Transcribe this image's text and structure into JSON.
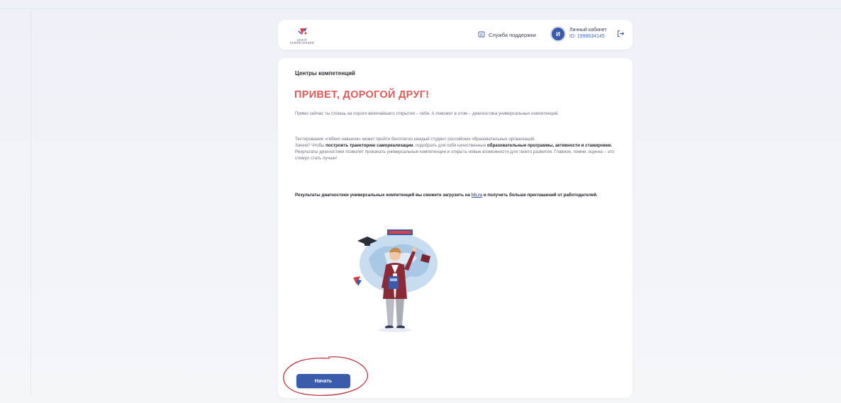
{
  "header": {
    "logo_text": "ЦЕНТР КОМПЕТЕНЦИЙ",
    "support_label": "Служба поддержки",
    "avatar_letter": "И",
    "account_label": "Личный кабинет",
    "account_id": "ID: 1998634145"
  },
  "main": {
    "section_title": "Центры компетенций",
    "greeting": "ПРИВЕТ, ДОРОГОЙ ДРУГ!",
    "p1": "Прямо сейчас ты стоишь на пороге величайшего открытия – себя. А поможет в этом – диагностика универсальных компетенций.",
    "p2_line1": "Тестирование «гибких навыков» может пройти бесплатно каждый студент российских образовательных организаций.",
    "p2_why": "Зачем? Чтобы ",
    "p2_bold1": "построить траекторию самореализации",
    "p2_mid": ", подобрать для себя качественные ",
    "p2_bold2": "образовательные программы, активности и стажировки.",
    "p2_line3": "Результаты диагностики позволят прокачать универсальные компетенции и открыть новые возможности для твоего развития. Главное, помни, оценка – это стимул стать лучше!",
    "p3_before": "Результаты диагностики универсальных компетенций вы сможете загрузить на ",
    "p3_link": "hh.ru",
    "p3_after": " и получить больше приглашений от работодателей.",
    "start_button": "Начать"
  },
  "colors": {
    "accent": "#3b5bab",
    "greeting": "#e05a5a",
    "highlight_circle": "#c0353b"
  }
}
